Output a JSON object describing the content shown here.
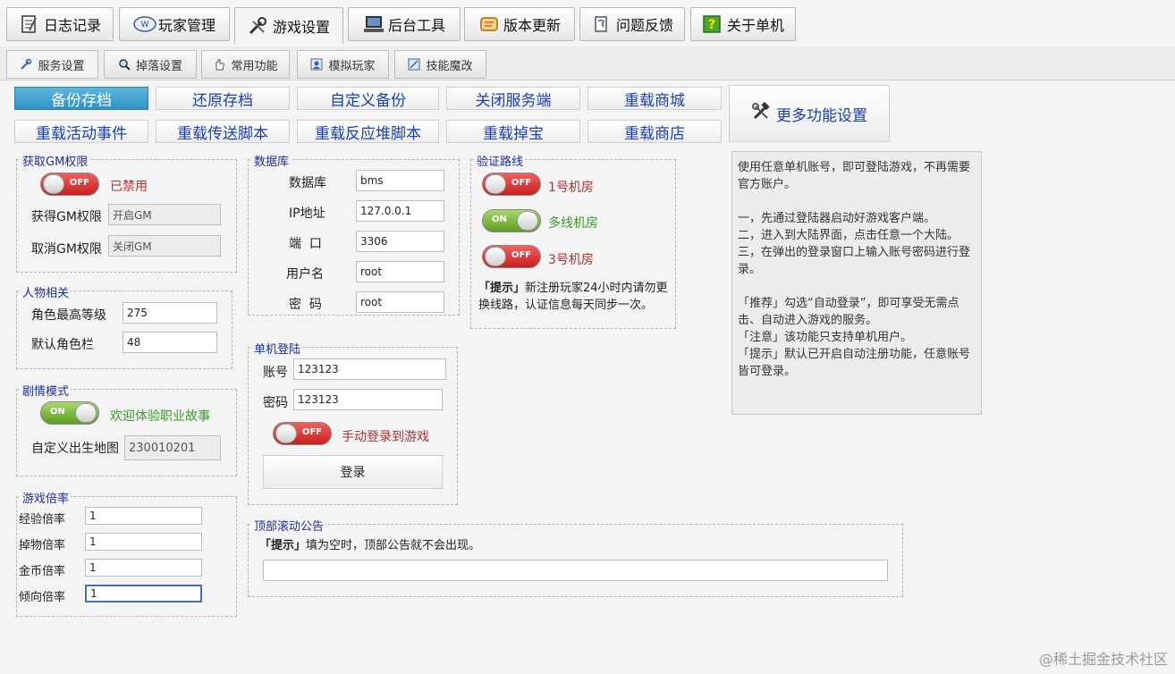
{
  "top_tabs": [
    {
      "label": "日志记录",
      "icon": "notebook-icon"
    },
    {
      "label": "玩家管理",
      "icon": "window-icon"
    },
    {
      "label": "游戏设置",
      "icon": "tools-icon"
    },
    {
      "label": "后台工具",
      "icon": "computer-icon"
    },
    {
      "label": "版本更新",
      "icon": "scroll-icon"
    },
    {
      "label": "问题反馈",
      "icon": "note-icon"
    },
    {
      "label": "关于单机",
      "icon": "help-icon"
    }
  ],
  "sub_tabs": [
    {
      "label": "服务设置"
    },
    {
      "label": "掉落设置"
    },
    {
      "label": "常用功能"
    },
    {
      "label": "模拟玩家"
    },
    {
      "label": "技能魔改"
    }
  ],
  "actions": {
    "row1": [
      "备份存档",
      "还原存档",
      "自定义备份",
      "关闭服务端",
      "重载商城"
    ],
    "row2": [
      "重载活动事件",
      "重载传送脚本",
      "重载反应堆脚本",
      "重载掉宝",
      "重载商店"
    ],
    "more": "更多功能设置"
  },
  "gm": {
    "title": "获取GM权限",
    "toggle": "OFF",
    "status": "已禁用",
    "get_label": "获得GM权限",
    "get_value": "开启GM",
    "cancel_label": "取消GM权限",
    "cancel_value": "关闭GM"
  },
  "character": {
    "title": "人物相关",
    "max_level_label": "角色最高等级",
    "max_level_value": "275",
    "default_slots_label": "默认角色栏",
    "default_slots_value": "48"
  },
  "story": {
    "title": "剧情模式",
    "toggle": "ON",
    "status": "欢迎体验职业故事",
    "map_label": "自定义出生地图",
    "map_value": "230010201"
  },
  "rates": {
    "title": "游戏倍率",
    "exp_label": "经验倍率",
    "exp_value": "1",
    "drop_label": "掉物倍率",
    "drop_value": "1",
    "gold_label": "金币倍率",
    "gold_value": "1",
    "tend_label": "倾向倍率",
    "tend_value": "1"
  },
  "database": {
    "title": "数据库",
    "db_label": "数据库",
    "db_value": "bms",
    "ip_label": "IP地址",
    "ip_value": "127.0.0.1",
    "port_label": "端  口",
    "port_value": "3306",
    "user_label": "用户名",
    "user_value": "root",
    "pwd_label": "密  码",
    "pwd_value": "root"
  },
  "route": {
    "title": "验证路线",
    "r1_toggle": "OFF",
    "r1_label": "1号机房",
    "r2_toggle": "ON",
    "r2_label": "多线机房",
    "r3_toggle": "OFF",
    "r3_label": "3号机房",
    "tip_tag": "「提示」",
    "tip_text": "新注册玩家24小时内请勿更换线路，认证信息每天同步一次。"
  },
  "login": {
    "title": "单机登陆",
    "account_label": "账号",
    "account_value": "123123",
    "password_label": "密码",
    "password_value": "123123",
    "toggle": "OFF",
    "manual_label": "手动登录到游戏",
    "button": "登录"
  },
  "notice": {
    "title": "顶部滚动公告",
    "tip_tag": "「提示」",
    "tip_text": "填为空时，顶部公告就不会出现。",
    "value": ""
  },
  "info": {
    "p1": "使用任意单机账号，即可登陆游戏，不再需要官方账户。",
    "p2_1": "一，先通过登陆器启动好游戏客户端。",
    "p2_2": "二，进入到大陆界面，点击任意一个大陆。",
    "p2_3": "三，在弹出的登录窗口上输入账号密码进行登录。",
    "p3_1": "「推荐」勾选“自动登录”，即可享受无需点击、自动进入游戏的服务。",
    "p3_2": "「注意」该功能只支持单机用户。",
    "p3_3": "「提示」默认已开启自动注册功能，任意账号皆可登录。"
  },
  "watermark": "@稀土掘金技术社区",
  "colors": {
    "title_blue": "#1a2fa0",
    "action_blue": "#1a3fb0",
    "primary": "#2f92c4",
    "off_red": "#c81e1e",
    "on_green": "#5f9e23",
    "status_red": "#b03030",
    "status_green": "#3a9a2a"
  }
}
